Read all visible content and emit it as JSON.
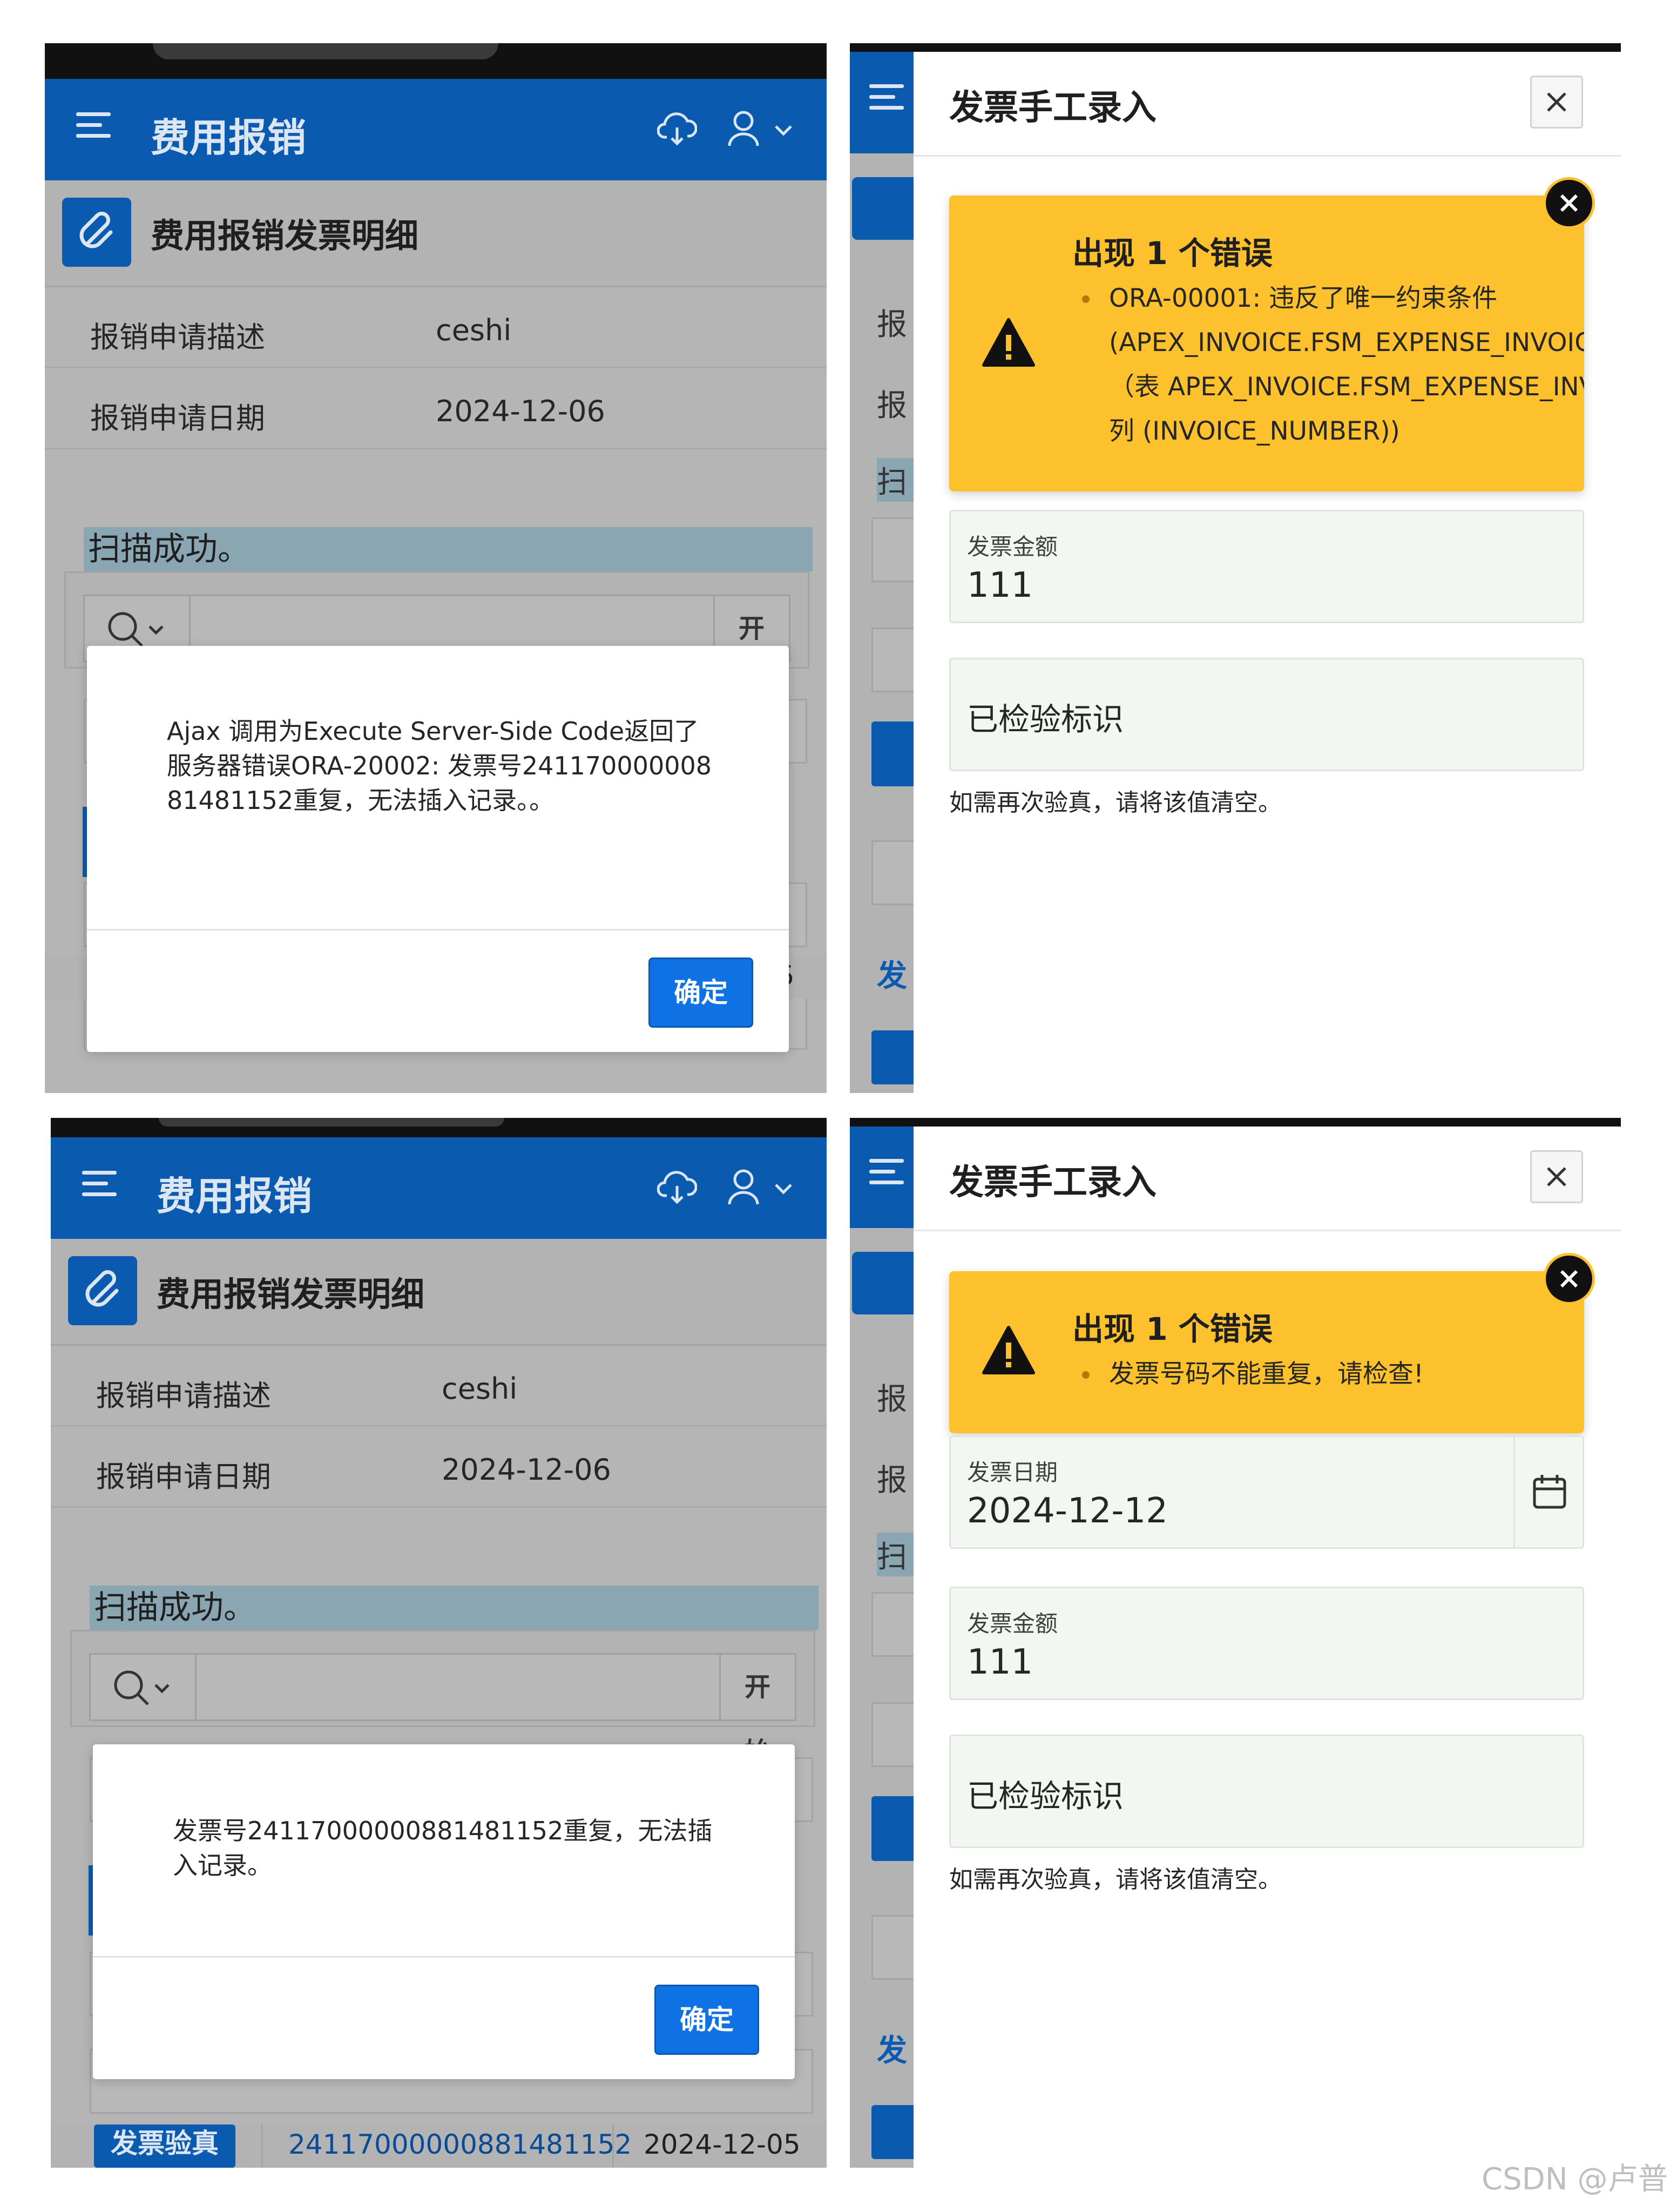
{
  "app": {
    "title": "费用报销",
    "region_title": "费用报销发票明细",
    "fields": [
      {
        "label": "报销申请描述",
        "value": "ceshi"
      },
      {
        "label": "报销申请日期",
        "value": "2024-12-06"
      }
    ],
    "success_msg": "扫描成功。",
    "search_go": "开始",
    "column_header_partial": "操作",
    "row": {
      "button": "发票验真",
      "invoice_no": "24117000000881481152",
      "date": "2024-12-05"
    }
  },
  "dialog_top": {
    "message": "Ajax 调用为Execute Server-Side Code返回了服务器错误ORA-20002: 发票号24117000000881481152重复，无法插入记录。。",
    "ok": "确定"
  },
  "dialog_bottom": {
    "message": "发票号24117000000881481152重复，无法插入记录。",
    "ok": "确定"
  },
  "drawer": {
    "title": "发票手工录入",
    "side_partial": [
      "报",
      "报",
      "扫",
      "发",
      "发"
    ]
  },
  "error_top": {
    "heading": "出现 1 个错误",
    "lines": [
      "ORA-00001: 违反了唯一约束条件",
      "(APEX_INVOICE.FSM_EXPENSE_INVOICE_ID",
      "（表 APEX_INVOICE.FSM_EXPENSE_INVOICE",
      "列 (INVOICE_NUMBER))"
    ]
  },
  "error_bottom": {
    "heading": "出现 1 个错误",
    "lines": [
      "发票号码不能重复，请检查!"
    ]
  },
  "form_top": {
    "amount_label": "发票金额",
    "amount_value": "111",
    "verified_label": "已检验标识",
    "help": "如需再次验真，请将该值清空。"
  },
  "form_bottom": {
    "date_label": "发票日期",
    "date_value": "2024-12-12",
    "amount_label": "发票金额",
    "amount_value": "111",
    "verified_label": "已检验标识",
    "help": "如需再次验真，请将该值清空。"
  },
  "watermark": "CSDN @卢普",
  "colors": {
    "primary": "#0a5ab0",
    "button": "#0e72e4",
    "alert": "#fcc12c",
    "overlay": "#b3b3b3"
  },
  "icons": [
    "menu-icon",
    "cloud-sync-icon",
    "user-icon",
    "paperclip-icon",
    "search-icon",
    "warning-icon",
    "close-icon",
    "calendar-icon"
  ]
}
